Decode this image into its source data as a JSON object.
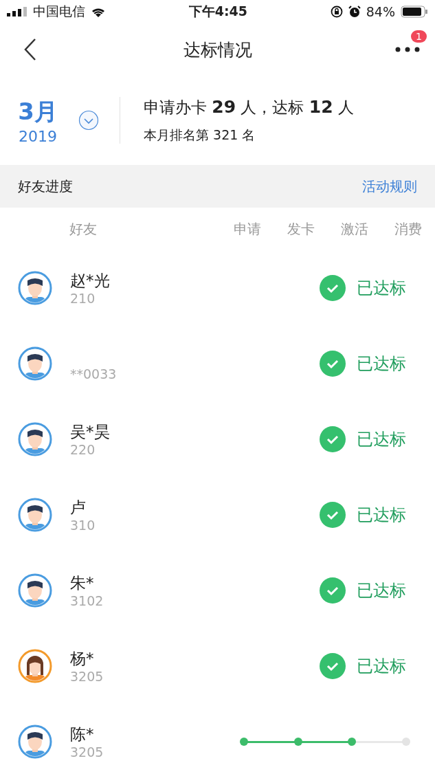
{
  "status_bar": {
    "carrier": "中国电信",
    "time": "下午4:45",
    "battery": "84%"
  },
  "nav": {
    "title": "达标情况",
    "badge": "1"
  },
  "summary": {
    "month": "3月",
    "year": "2019",
    "line1": "申请办卡 **29** 人，达标 **12** 人",
    "line2": "本月排名第 321 名"
  },
  "section": {
    "title": "好友进度",
    "link": "活动规则"
  },
  "columns": [
    "好友",
    "申请",
    "发卡",
    "激活",
    "消费"
  ],
  "rows": [
    {
      "avatar": {
        "kind": "male"
      },
      "name": "赵*光",
      "id": "210",
      "kind": "done",
      "status": "已达标"
    },
    {
      "avatar": {
        "kind": "male"
      },
      "id": "**0033",
      "kind": "done",
      "status": "已达标"
    },
    {
      "avatar": {
        "kind": "male"
      },
      "name": "吴*昊",
      "id": "220",
      "kind": "done",
      "status": "已达标"
    },
    {
      "avatar": {
        "kind": "male"
      },
      "name": "卢",
      "id": "310",
      "kind": "done",
      "status": "已达标"
    },
    {
      "avatar": {
        "kind": "male"
      },
      "name": "朱*",
      "id": "3102",
      "kind": "done",
      "status": "已达标"
    },
    {
      "avatar": {
        "kind": "female"
      },
      "name": "杨*",
      "id": "3205",
      "kind": "done",
      "status": "已达标"
    },
    {
      "avatar": {
        "kind": "male"
      },
      "name": "陈*",
      "id": "3205",
      "kind": "progress",
      "level": 0.67
    }
  ]
}
